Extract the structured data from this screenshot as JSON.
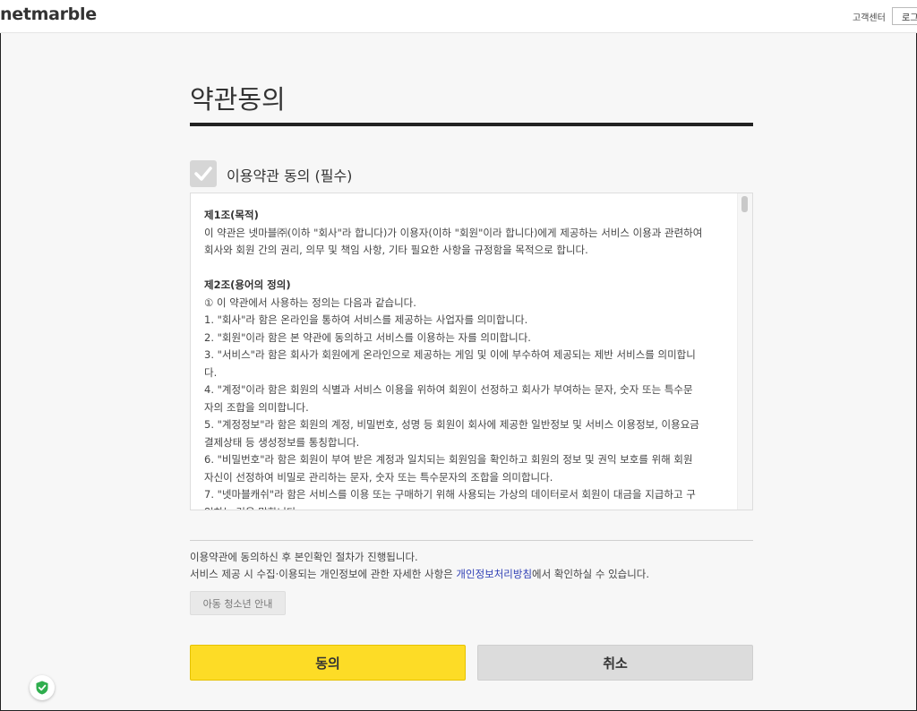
{
  "header": {
    "logo": "netmarble",
    "help_link": "고객센터",
    "login_button": "로그인"
  },
  "page": {
    "title": "약관동의",
    "checkbox_label": "이용약관 동의 (필수)",
    "checked": true
  },
  "terms": {
    "lines": [
      {
        "text": "제1조(목적)",
        "heading": true
      },
      {
        "text": "이 약관은 넷마블㈜(이하 \"회사\"라 합니다)가 이용자(이하 \"회원\"이라 합니다)에게 제공하는 서비스 이용과 관련하여"
      },
      {
        "text": "회사와 회원 간의 권리, 의무 및 책임 사항, 기타 필요한 사항을 규정함을 목적으로 합니다."
      },
      {
        "text": "",
        "gap": true
      },
      {
        "text": "제2조(용어의 정의)",
        "heading": true
      },
      {
        "text": " ① 이 약관에서 사용하는 정의는 다음과 같습니다."
      },
      {
        "text": "  1. \"회사\"라 함은 온라인을 통하여 서비스를 제공하는 사업자를 의미합니다."
      },
      {
        "text": "  2. \"회원\"이라 함은 본 약관에 동의하고 서비스를 이용하는 자를 의미합니다."
      },
      {
        "text": "  3. \"서비스\"라 함은 회사가 회원에게 온라인으로 제공하는 게임 및 이에 부수하여 제공되는 제반 서비스를 의미합니"
      },
      {
        "text": "다."
      },
      {
        "text": "  4. \"계정\"이라 함은 회원의 식별과 서비스 이용을 위하여 회원이 선정하고 회사가 부여하는 문자, 숫자 또는 특수문"
      },
      {
        "text": "자의 조합을 의미합니다."
      },
      {
        "text": "  5. \"계정정보\"라 함은 회원의 계정, 비밀번호, 성명 등 회원이 회사에 제공한 일반정보 및 서비스 이용정보, 이용요금"
      },
      {
        "text": "결제상태 등 생성정보를 통칭합니다."
      },
      {
        "text": "  6. \"비밀번호\"라 함은 회원이 부여 받은 계정과 일치되는 회원임을 확인하고 회원의 정보 및 권익 보호를 위해 회원"
      },
      {
        "text": "자신이 선정하여 비밀로 관리하는 문자, 숫자 또는 특수문자의 조합을 의미합니다."
      },
      {
        "text": "  7. \"넷마블캐쉬\"라 함은 서비스를 이용 또는 구매하기 위해 사용되는 가상의 데이터로서 회원이 대금을 지급하고 구"
      },
      {
        "text": "입하는 것을 말합니다."
      }
    ]
  },
  "notice": {
    "line1": "이용약관에 동의하신 후 본인확인 절차가 진행됩니다.",
    "line2_before": "서비스 제공 시 수집·이용되는 개인정보에 관한 자세한 사항은 ",
    "privacy_link": "개인정보처리방침",
    "line2_after": "에서 확인하실 수 있습니다."
  },
  "buttons": {
    "child_guide": "아동 청소년 안내",
    "agree": "동의",
    "cancel": "취소"
  },
  "icons": {
    "checkmark": "check-icon",
    "shield": "shield-check-icon"
  },
  "colors": {
    "agree": "#fddc26",
    "cancel": "#dcdcdc",
    "link": "#2f3fb5",
    "title_rule": "#222222"
  }
}
